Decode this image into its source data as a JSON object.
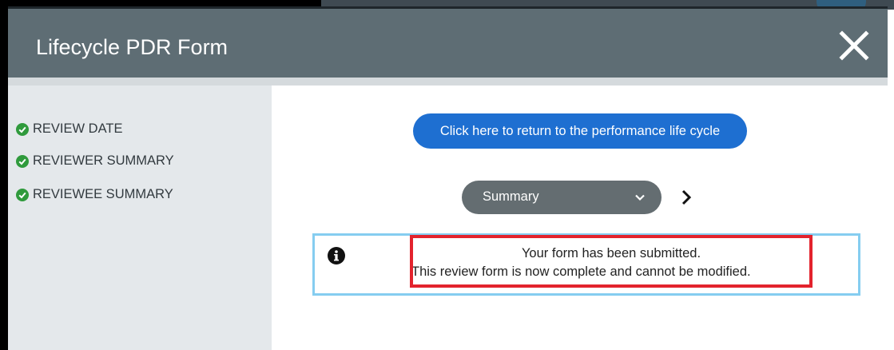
{
  "modal": {
    "title": "Lifecycle PDR Form",
    "close_icon": "close-x-icon"
  },
  "sidebar": {
    "items": [
      {
        "label": "REVIEW DATE",
        "icon": "check-circle-icon",
        "status": "complete"
      },
      {
        "label": "REVIEWER SUMMARY",
        "icon": "check-circle-icon",
        "status": "complete"
      },
      {
        "label": "REVIEWEE SUMMARY",
        "icon": "check-circle-icon",
        "status": "complete"
      }
    ]
  },
  "main": {
    "return_button_label": "Click here to return to the performance life cycle",
    "section_select": {
      "selected": "Summary",
      "icon": "chevron-down-icon"
    },
    "next_icon": "chevron-right-icon",
    "notice": {
      "icon": "info-circle-icon",
      "line1": "Your form has been submitted.",
      "line2": "This review form is now complete and cannot be modified."
    }
  },
  "colors": {
    "header_bg": "#5e6d74",
    "sidebar_bg": "#e4e8eb",
    "primary_button": "#1e6fd1",
    "select_bg": "#646d71",
    "check_green": "#2f9a3c",
    "notice_border": "#85cdf0",
    "highlight_red": "#e3232d"
  }
}
